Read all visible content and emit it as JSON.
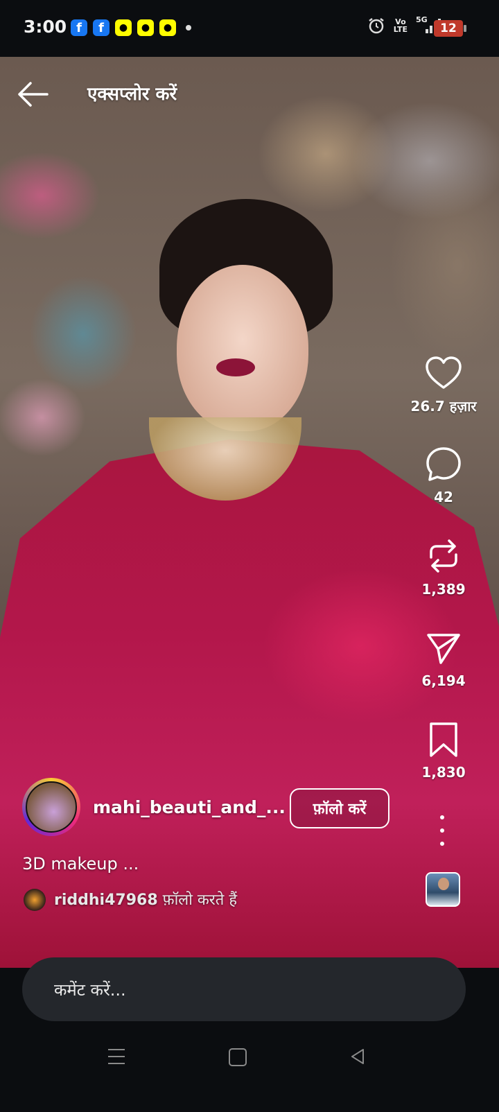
{
  "status_bar": {
    "time": "3:00",
    "notifications": [
      "facebook-icon",
      "facebook-icon",
      "snapchat-icon",
      "snapchat-icon",
      "snapchat-icon"
    ],
    "network_vo": "Vo",
    "network_lte": "LTE",
    "network_5g": "5G",
    "battery": "12"
  },
  "header": {
    "title": "एक्सप्लोर करें"
  },
  "actions": {
    "likes": "26.7 हज़ार",
    "comments": "42",
    "reposts": "1,389",
    "shares": "6,194",
    "saves": "1,830"
  },
  "post": {
    "username": "mahi_beauti_and_...",
    "follow_label": "फ़ॉलो करें",
    "caption": "3D makeup ...",
    "followed_by_user": "riddhi47968",
    "followed_by_suffix": " फ़ॉलो करते हैं"
  },
  "comment": {
    "placeholder": "कमेंट करें..."
  },
  "colors": {
    "background": "#0b0d10",
    "comment_field": "#24272c",
    "battery_low": "#c0392b"
  }
}
